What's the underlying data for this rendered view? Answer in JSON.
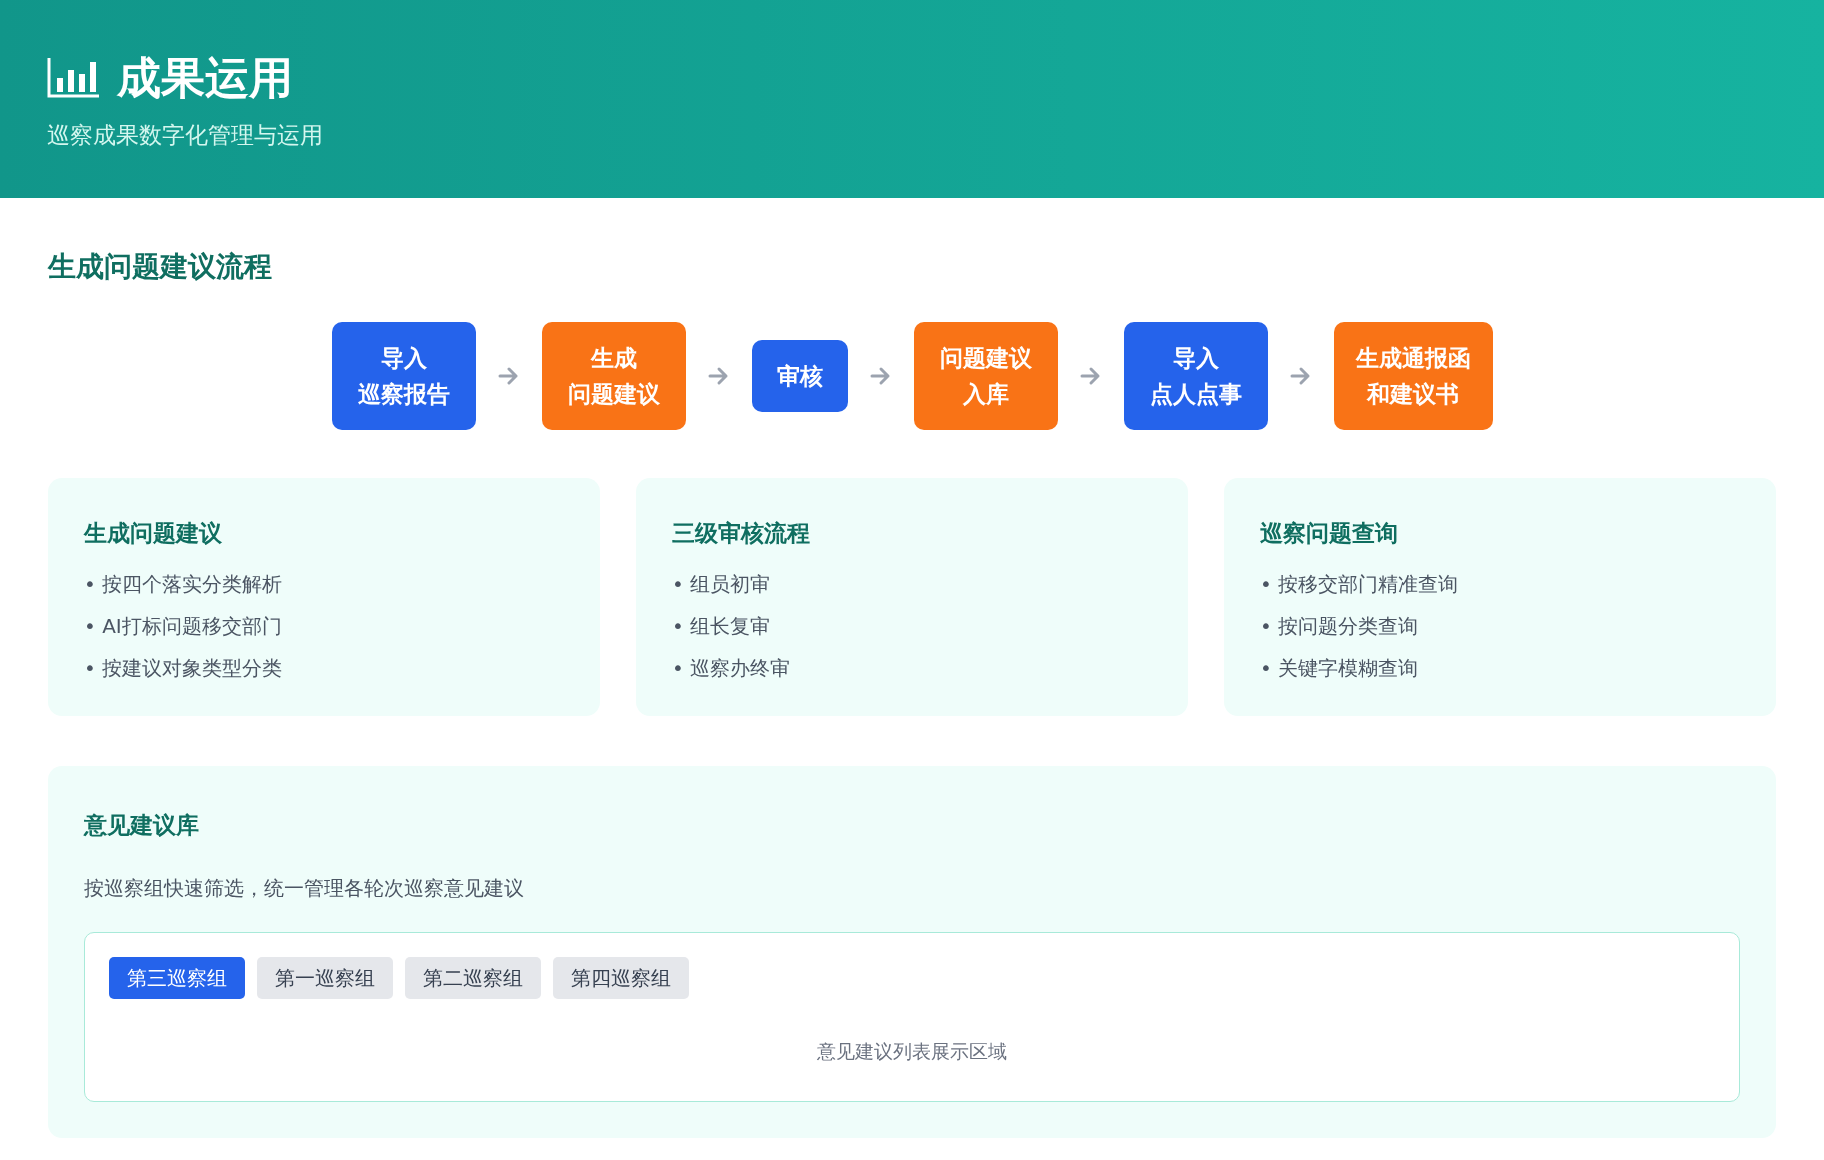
{
  "header": {
    "title": "成果运用",
    "subtitle": "巡察成果数字化管理与运用"
  },
  "flow": {
    "title": "生成问题建议流程",
    "steps": [
      {
        "lines": [
          "导入",
          "巡察报告"
        ],
        "color": "#2563eb"
      },
      {
        "lines": [
          "生成",
          "问题建议"
        ],
        "color": "#f97316"
      },
      {
        "lines": [
          "审核"
        ],
        "color": "#2563eb"
      },
      {
        "lines": [
          "问题建议",
          "入库"
        ],
        "color": "#f97316"
      },
      {
        "lines": [
          "导入",
          "点人点事"
        ],
        "color": "#2563eb"
      },
      {
        "lines": [
          "生成通报函",
          "和建议书"
        ],
        "color": "#f97316"
      }
    ]
  },
  "cards": [
    {
      "title": "生成问题建议",
      "items": [
        "• 按四个落实分类解析",
        "• AI打标问题移交部门",
        "• 按建议对象类型分类"
      ]
    },
    {
      "title": "三级审核流程",
      "items": [
        "• 组员初审",
        "• 组长复审",
        "• 巡察办终审"
      ]
    },
    {
      "title": "巡察问题查询",
      "items": [
        "• 按移交部门精准查询",
        "• 按问题分类查询",
        "• 关键字模糊查询"
      ]
    }
  ],
  "library": {
    "title": "意见建议库",
    "description": "按巡察组快速筛选，统一管理各轮次巡察意见建议",
    "tabs": [
      {
        "label": "第三巡察组",
        "selected": true
      },
      {
        "label": "第一巡察组",
        "selected": false
      },
      {
        "label": "第二巡察组",
        "selected": false
      },
      {
        "label": "第四巡察组",
        "selected": false
      }
    ],
    "placeholder": "意见建议列表展示区域"
  }
}
